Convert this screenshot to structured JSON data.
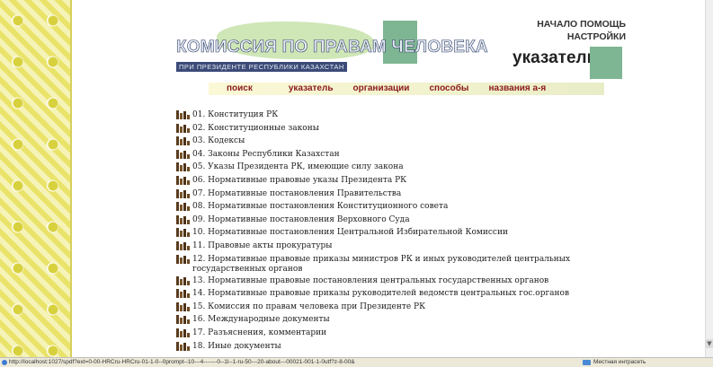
{
  "header": {
    "logo_title": "КОМИССИЯ ПО ПРАВАМ ЧЕЛОВЕКА",
    "logo_subtitle": "ПРИ ПРЕЗИДЕНТЕ РЕСПУБЛИКИ КАЗАХСТАН",
    "top_links": {
      "home": "НАЧАЛО",
      "help": "ПОМОЩЬ",
      "settings": "НАСТРОЙКИ"
    },
    "section_title": "указатель"
  },
  "nav": [
    "поиск",
    "указатель",
    "организации",
    "способы",
    "названия а-я"
  ],
  "index_items": [
    "01. Конституция РК",
    "02. Конституционные законы",
    "03. Кодексы",
    "04. Законы Республики Казахстан",
    "05. Указы Президента РК, имеющие силу закона",
    "06. Нормативные правовые указы Президента РК",
    "07. Нормативные постановления Правительства",
    "08. Нормативные постановления Конституционного совета",
    "09. Нормативные постановления Верховного Суда",
    "10. Нормативные постановления Центральной Избирательной Комиссии",
    "11. Правовые акты прокуратуры",
    "12. Нормативные правовые приказы министров РК и иных руководителей центральных государственных органов",
    "13. Нормативные правовые постановления центральных государственных органов",
    "14. Нормативные правовые приказы руководителей ведомств центральных гос.органов",
    "15. Комиссия по правам человека при Президенте РК",
    "16. Международные документы",
    "17. Разъяснения, комментарии",
    "18. Иные документы"
  ],
  "statusbar": {
    "url": "http://localhost:1027/spdf?ext=0-00-HRCru-HRCru-01-1-0--0prompt--10---4-------0--1l--1-ru-50---20-about---00021-001-1-0utf?z-8-00&",
    "zone": "Местная интрасеть"
  }
}
